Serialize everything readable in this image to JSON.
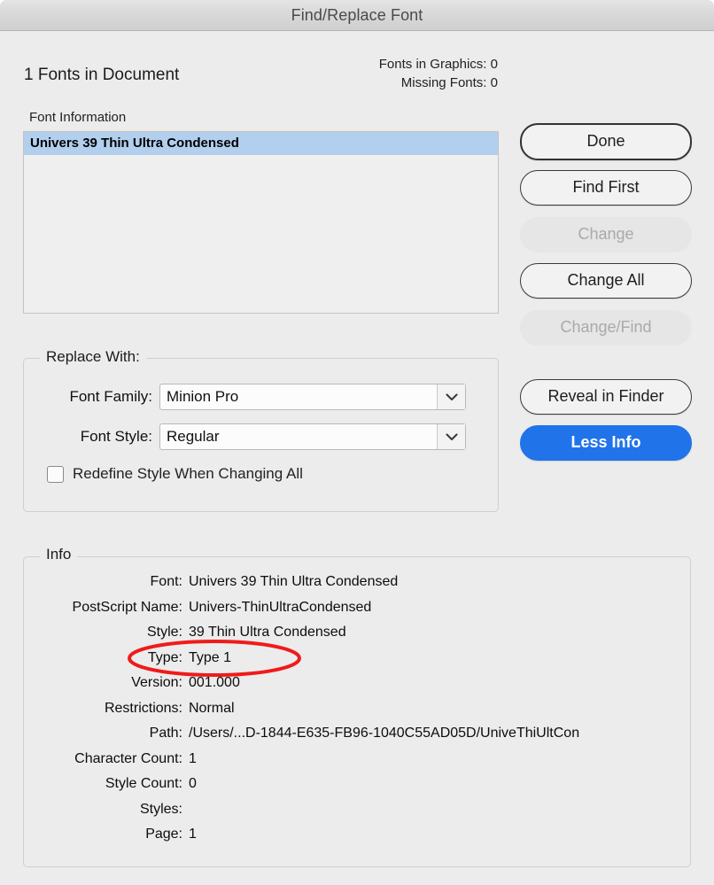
{
  "window": {
    "title": "Find/Replace Font"
  },
  "header": {
    "fonts_in_document": "1 Fonts in Document",
    "fonts_in_graphics": "Fonts in Graphics: 0",
    "missing_fonts": "Missing Fonts: 0"
  },
  "font_list": {
    "label": "Font Information",
    "items": [
      {
        "name": "Univers 39 Thin Ultra Condensed",
        "selected": true
      }
    ]
  },
  "replace_with": {
    "legend": "Replace With:",
    "font_family": {
      "label": "Font Family:",
      "value": "Minion Pro"
    },
    "font_style": {
      "label": "Font Style:",
      "value": "Regular"
    },
    "redefine_style": {
      "label": "Redefine Style When Changing All",
      "checked": false
    }
  },
  "buttons": {
    "done": "Done",
    "find_first": "Find First",
    "change": "Change",
    "change_all": "Change All",
    "change_find": "Change/Find",
    "reveal_in_finder": "Reveal in Finder",
    "less_info": "Less Info"
  },
  "info": {
    "legend": "Info",
    "rows": [
      {
        "key": "Font:",
        "value": "Univers 39 Thin Ultra Condensed"
      },
      {
        "key": "PostScript Name:",
        "value": "Univers-ThinUltraCondensed"
      },
      {
        "key": "Style:",
        "value": "39 Thin Ultra Condensed"
      },
      {
        "key": "Type:",
        "value": "Type 1"
      },
      {
        "key": "Version:",
        "value": "001.000"
      },
      {
        "key": "Restrictions:",
        "value": "Normal"
      },
      {
        "key": "Path:",
        "value": "/Users/...D-1844-E635-FB96-1040C55AD05D/UniveThiUltCon"
      },
      {
        "key": "Character Count:",
        "value": "1"
      },
      {
        "key": "Style Count:",
        "value": "0"
      },
      {
        "key": "Styles:",
        "value": ""
      },
      {
        "key": "Page:",
        "value": "1"
      }
    ]
  },
  "annotation": {
    "shape": "ellipse",
    "color": "#ef1b1b",
    "targets": "Type: Type 1"
  },
  "colors": {
    "accent_blue": "#2173ea",
    "selection_blue": "#b2cfee",
    "window_bg": "#ececec",
    "annotation_red": "#ef1b1b"
  }
}
